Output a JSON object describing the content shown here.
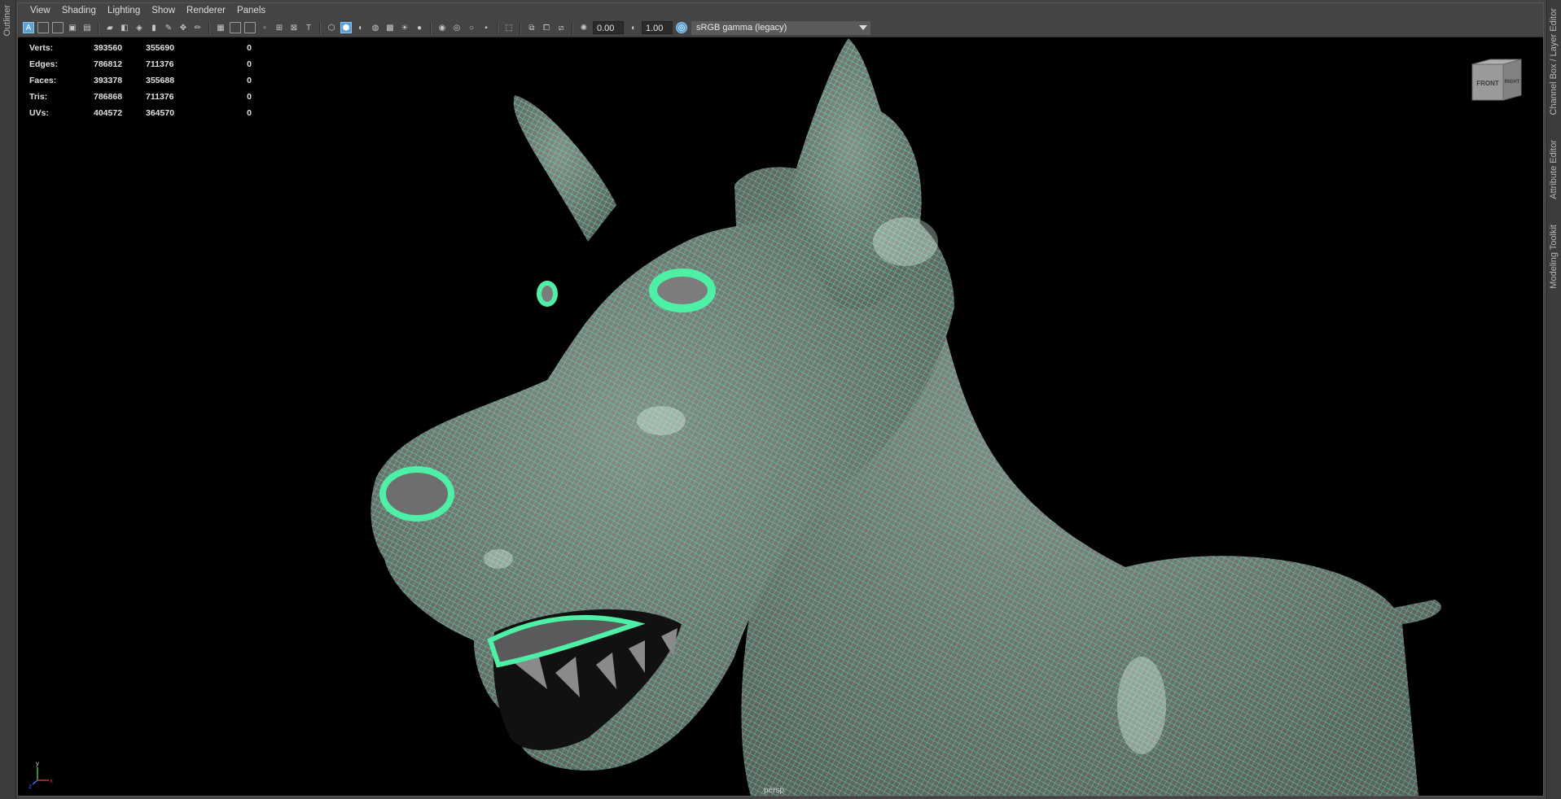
{
  "left_strip": {
    "outliner_label": "Outliner"
  },
  "right_strip": {
    "channel_box_label": "Channel Box / Layer Editor",
    "attribute_editor_label": "Attribute Editor",
    "modeling_toolkit_label": "Modeling Toolkit"
  },
  "menu": [
    "View",
    "Shading",
    "Lighting",
    "Show",
    "Renderer",
    "Panels"
  ],
  "toolbar": {
    "exposure_value": "0.00",
    "gamma_value": "1.00",
    "colorspace": "sRGB gamma (legacy)",
    "icons": [
      "select-camera-icon",
      "camera-attributes-icon",
      "bookmarks-icon",
      "image-plane-icon",
      "grid-icon",
      "film-gate-icon",
      "resolution-gate-icon",
      "gate-mask-icon",
      "field-chart-icon",
      "safe-action-icon",
      "safe-title-icon",
      "wireframe-icon",
      "smooth-shade-icon",
      "wireframe-on-shaded-icon",
      "xray-icon",
      "textured-icon",
      "lights-icon",
      "shadows-icon",
      "ambient-occlusion-icon",
      "motion-blur-icon",
      "isolate-select-icon",
      "xray-joints-icon",
      "exposure-icon",
      "gamma-icon",
      "color-management-icon"
    ]
  },
  "hud": {
    "rows": [
      {
        "label": "Verts:",
        "a": "393560",
        "b": "355690",
        "c": "0"
      },
      {
        "label": "Edges:",
        "a": "786812",
        "b": "711376",
        "c": "0"
      },
      {
        "label": "Faces:",
        "a": "393378",
        "b": "355688",
        "c": "0"
      },
      {
        "label": "Tris:",
        "a": "786868",
        "b": "711376",
        "c": "0"
      },
      {
        "label": "UVs:",
        "a": "404572",
        "b": "364570",
        "c": "0"
      }
    ]
  },
  "viewcube": {
    "front": "FRONT",
    "right": "RIGHT"
  },
  "axis": {
    "x": "x",
    "y": "y",
    "z": "z"
  },
  "camera_name": "persp",
  "colors": {
    "wireframe": "#4ef0a6",
    "mesh": "#7a7a7a",
    "panel_bg": "#444444",
    "viewport_bg": "#000000",
    "active_icon": "#5a9fd6"
  }
}
